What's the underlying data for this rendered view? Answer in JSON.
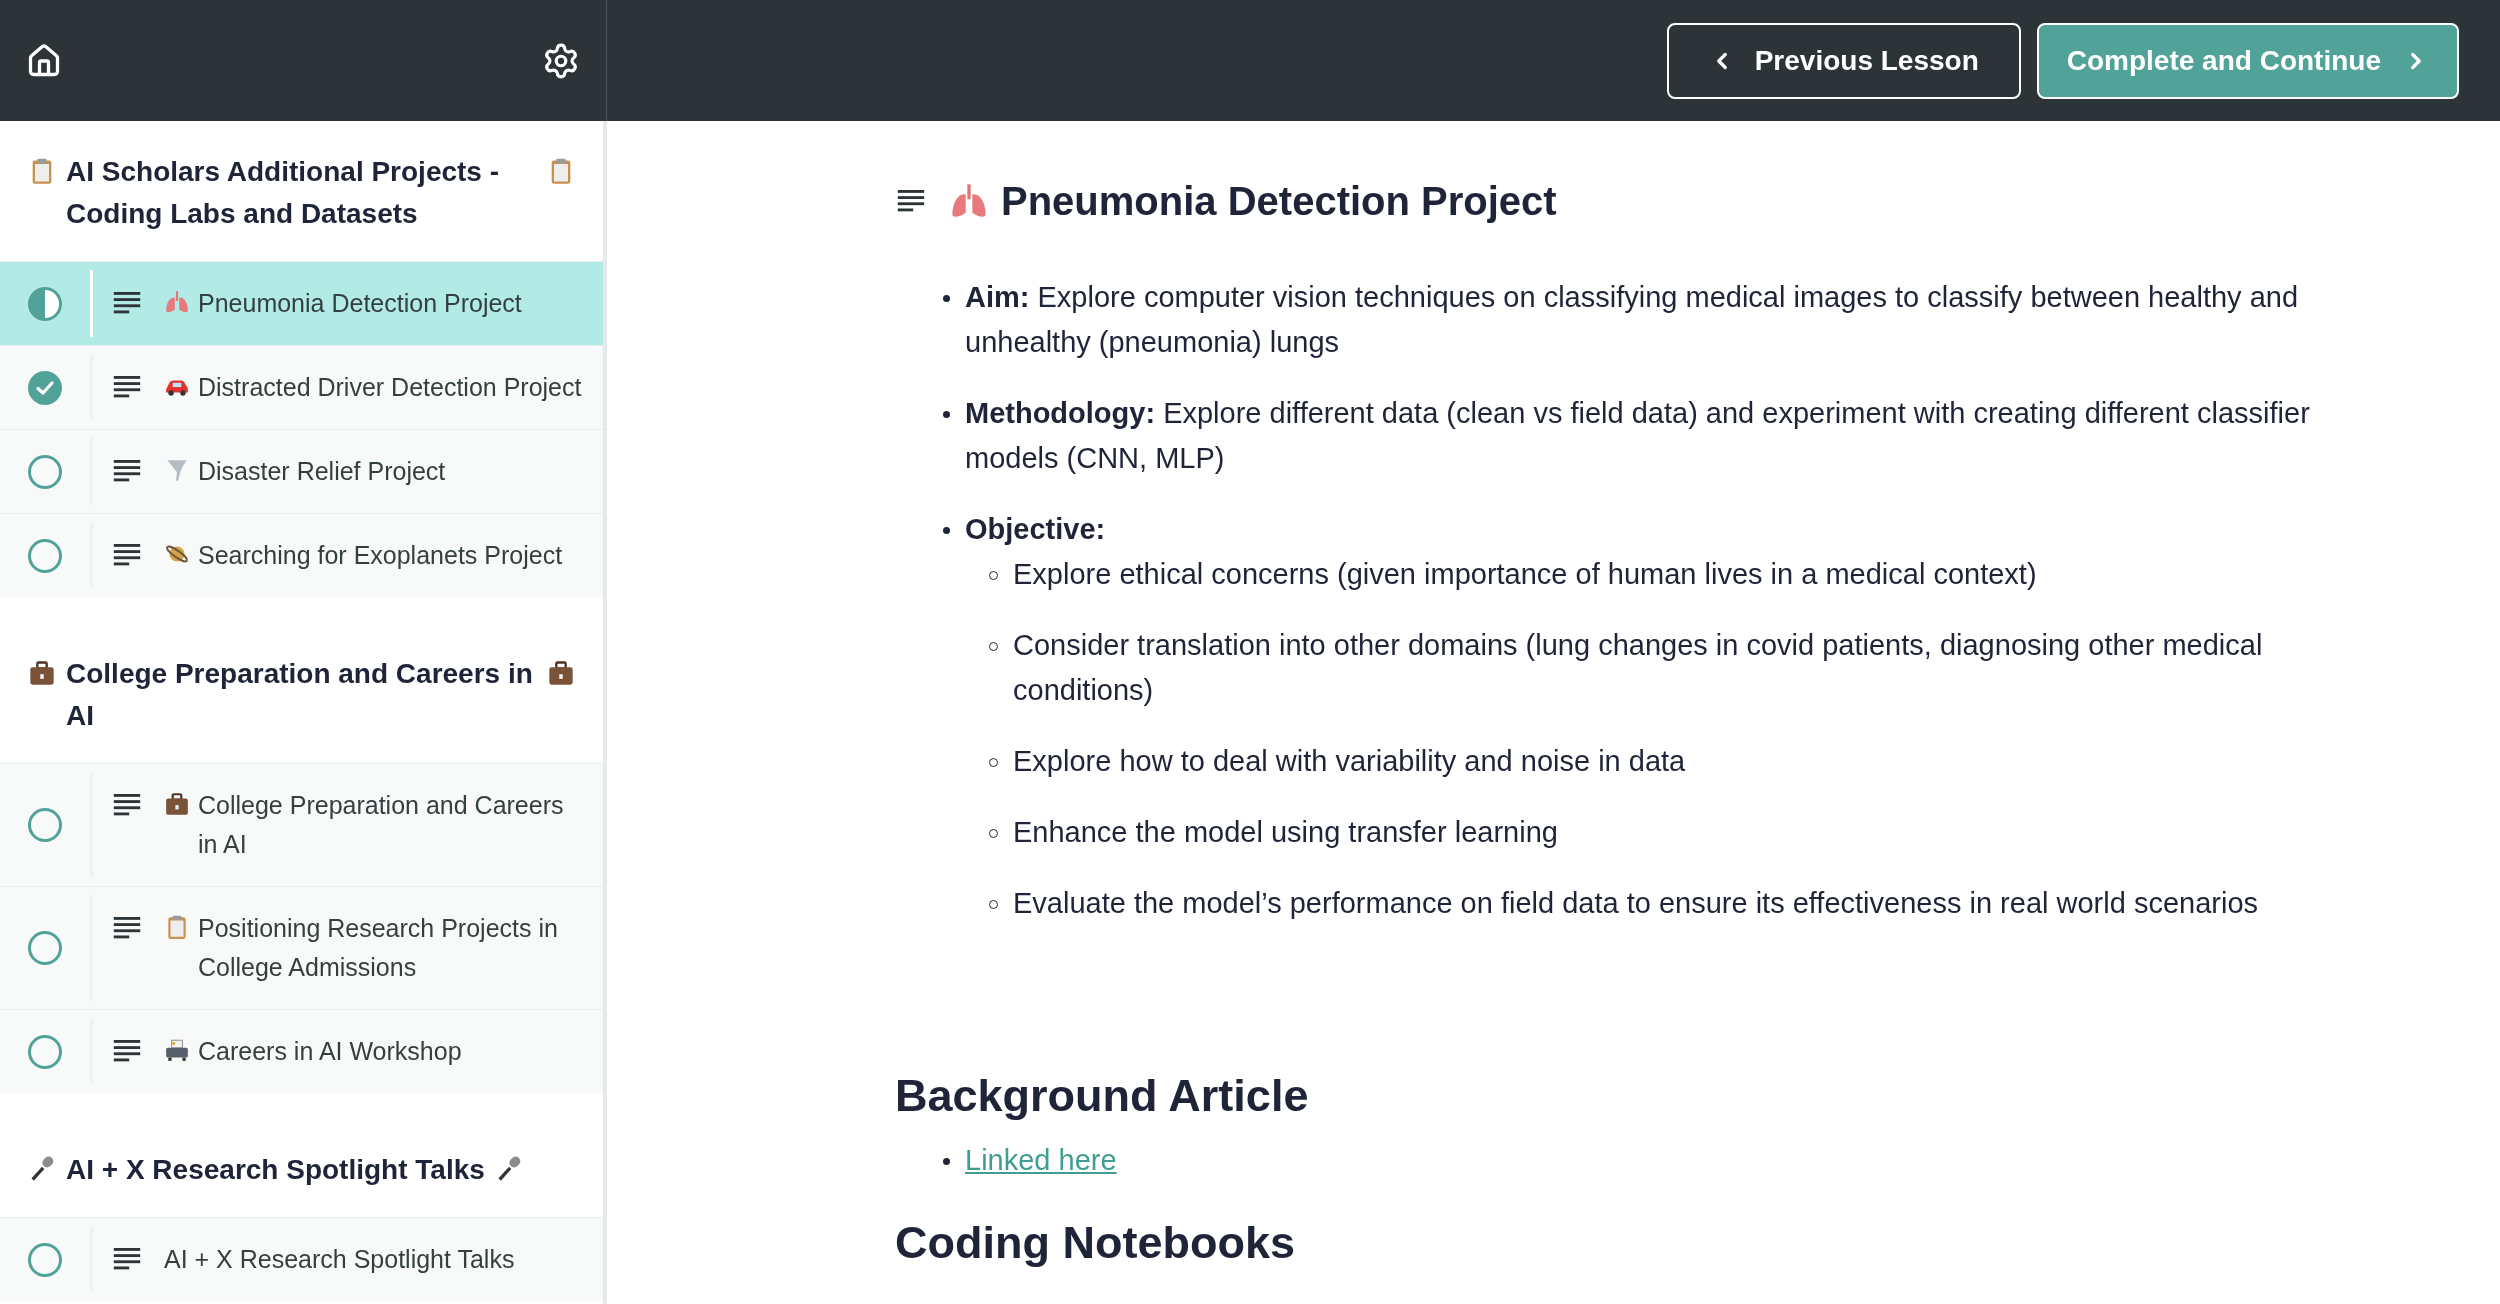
{
  "header": {
    "buttons": [
      {
        "kind": "previous",
        "label": "Previous Lesson"
      },
      {
        "kind": "next",
        "label": "Complete and Continue"
      }
    ]
  },
  "sidebar": {
    "sections": [
      {
        "title": "AI Scholars Additional Projects - Coding Labs and Datasets",
        "lessons": [
          {
            "title": "Pneumonia Detection Project",
            "kind": "in_progress",
            "selected": true
          },
          {
            "title": "Distracted Driver Detection Project",
            "kind": "complete",
            "selected": false
          },
          {
            "title": "Disaster Relief Project",
            "kind": "not_started",
            "selected": false
          },
          {
            "title": "Searching for Exoplanets Project",
            "kind": "not_started",
            "selected": false
          }
        ]
      },
      {
        "title": "College Preparation and Careers in AI",
        "lessons": [
          {
            "title": "College Preparation and Careers in AI",
            "kind": "not_started",
            "selected": false
          },
          {
            "title": "Positioning Research Projects in College Admissions",
            "kind": "not_started",
            "selected": false
          },
          {
            "title": "Careers in AI Workshop",
            "kind": "not_started",
            "selected": false
          }
        ]
      },
      {
        "title": "AI + X Research Spotlight Talks",
        "lessons": [
          {
            "title": "AI + X Research Spotlight Talks",
            "kind": "not_started",
            "selected": false
          }
        ]
      }
    ]
  },
  "lesson": {
    "title": "Pneumonia Detection Project",
    "bullets": [
      {
        "text": "**Aim:** Explore computer vision techniques on classifying medical images to classify between healthy and unhealthy (pneumonia) lungs"
      },
      {
        "text": "**Methodology:** Explore different data (clean vs field data) and experiment with creating different classifier models (CNN, MLP)"
      },
      {
        "text": "**Objective:**",
        "children": [
          "Explore ethical concerns (given importance of human lives in a medical context)",
          "Consider translation into other domains (lung changes in covid patients, diagnosing other medical conditions)",
          "Explore how to deal with variability and noise in data",
          "Enhance the model using transfer learning",
          "Evaluate the model’s performance on field data to ensure its effectiveness in real world scenarios"
        ]
      }
    ],
    "sections": [
      {
        "heading": "Background Article",
        "links": [
          "Linked here"
        ]
      },
      {
        "heading": "Coding Notebooks"
      }
    ]
  }
}
